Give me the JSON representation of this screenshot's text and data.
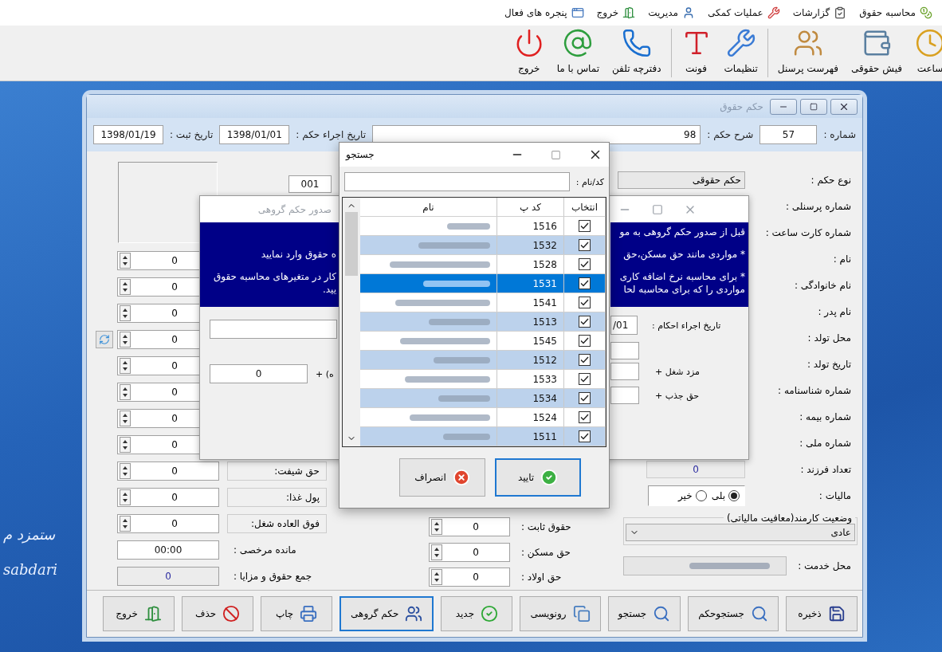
{
  "menu": [
    "محاسبه حقوق",
    "گزارشات",
    "عملیات کمکی",
    "مدیریت",
    "خروج",
    "پنجره های فعال"
  ],
  "toolbar": [
    [
      "ساعت",
      "فیش حقوقی",
      "فهرست پرسنل"
    ],
    [
      "تنظیمات",
      "فونت"
    ],
    [
      "دفترچه تلفن",
      "تماس با ما",
      "خروج"
    ]
  ],
  "desktop_text": [
    "ستمزد م",
    "sabdari"
  ],
  "main_window": {
    "title": "حکم حقوق",
    "header": [
      {
        "label": "شماره :",
        "value": "57"
      },
      {
        "label": "شرح حکم :",
        "value": "98"
      },
      {
        "label": "تاریخ اجراء حکم :",
        "value": "1398/01/01"
      },
      {
        "label": "تاریخ ثبت :",
        "value": "1398/01/19"
      }
    ],
    "code_field": "001",
    "left_rows": [
      {
        "kind": "spin",
        "value": "0"
      },
      {
        "kind": "spin",
        "value": "0"
      },
      {
        "kind": "spin",
        "value": "0"
      },
      {
        "kind": "spin",
        "value": "0",
        "refresh_button": true
      },
      {
        "kind": "spin",
        "value": "0"
      },
      {
        "kind": "spin",
        "value": "0"
      },
      {
        "kind": "spin",
        "value": "0"
      },
      {
        "kind": "spin",
        "value": "0"
      },
      {
        "kind": "spin",
        "value": "0",
        "label": "حق شیفت:"
      },
      {
        "kind": "spin",
        "value": "0",
        "label": "پول غذا:"
      },
      {
        "kind": "spin",
        "value": "0",
        "label": "فوق العاده شغل:"
      },
      {
        "kind": "time",
        "value": "00:00",
        "label": "مانده مرخصی :"
      },
      {
        "kind": "total",
        "value": "0",
        "label": "جمع حقوق و مزایا :"
      }
    ],
    "middle_rows": [
      {
        "label": "حقوق ثابت :",
        "value": "0"
      },
      {
        "label": "حق مسکن :",
        "value": "0"
      },
      {
        "label": "حق اولاد :",
        "value": "0"
      }
    ],
    "right_rows": [
      {
        "kind": "select",
        "label": "نوع حکم :",
        "value": "حکم حقوقی"
      },
      {
        "kind": "label",
        "label": "شماره پرسنلی :"
      },
      {
        "kind": "label",
        "label": "شماره کارت ساعت :"
      },
      {
        "kind": "label",
        "label": "نام :"
      },
      {
        "kind": "label",
        "label": "نام خانوادگی :"
      },
      {
        "kind": "label",
        "label": "نام پدر :"
      },
      {
        "kind": "label",
        "label": "محل تولد :"
      },
      {
        "kind": "label",
        "label": "تاریخ تولد :"
      },
      {
        "kind": "label",
        "label": "شماره شناسنامه :"
      },
      {
        "kind": "label",
        "label": "شماره بیمه :"
      },
      {
        "kind": "label",
        "label": "شماره ملی :"
      },
      {
        "kind": "readonly",
        "label": "تعداد فرزند :",
        "value": "0"
      },
      {
        "kind": "radio",
        "label": "مالیات :",
        "options": [
          {
            "label": "بلی",
            "selected": true
          },
          {
            "label": "خیر",
            "selected": false
          }
        ]
      }
    ],
    "status_group": {
      "title": "وضعیت کارمند(معافیت مالیاتی)",
      "value": "عادی"
    },
    "service_place": {
      "label": "محل خدمت :"
    },
    "buttons": [
      {
        "label": "ذخیره",
        "focused": false
      },
      {
        "label": "جستجوحکم",
        "focused": false
      },
      {
        "label": "جستجو",
        "focused": false
      },
      {
        "label": "رونویسی",
        "focused": false
      },
      {
        "label": "جدید",
        "focused": false
      },
      {
        "label": "حکم گروهی",
        "focused": true
      },
      {
        "label": "چاپ",
        "focused": false
      },
      {
        "label": "حذف",
        "focused": false
      },
      {
        "label": "خروج",
        "focused": false
      }
    ]
  },
  "group_dialog": {
    "title": "صدور حکم گروهی",
    "notice_lines": [
      {
        "kind": "start",
        "right": "قبل از صدور حکم گروهی به مو"
      },
      {
        "kind": "start",
        "right": "* مواردی مانند حق مسکن،حق",
        "left": "ه حقوق وارد نمایید"
      },
      {
        "kind": "start",
        "right": "* برای محاسبه نرخ اضافه کاری",
        "left": "کار در متغیرهای محاسبه حقوق"
      },
      {
        "kind": "continued",
        "right": "مواردی را که برای محاسبه لحا",
        "left": "یید."
      }
    ],
    "amount": {
      "value": "0",
      "label": "ه) +"
    },
    "date_label": "تاریخ اجراء احکام :",
    "date_value": "/01",
    "additions": [
      "مزد شغل +",
      "حق جذب +"
    ]
  },
  "search_dialog": {
    "title": "جستجو",
    "field_label": "کد/نام :",
    "columns": [
      "انتخاب",
      "کد پ",
      "نام"
    ],
    "rows": [
      {
        "code": "1516",
        "checked": true,
        "selected": false
      },
      {
        "code": "1532",
        "checked": true,
        "selected": false
      },
      {
        "code": "1528",
        "checked": true,
        "selected": false
      },
      {
        "code": "1531",
        "checked": true,
        "selected": true
      },
      {
        "code": "1541",
        "checked": true,
        "selected": false
      },
      {
        "code": "1513",
        "checked": true,
        "selected": false
      },
      {
        "code": "1545",
        "checked": true,
        "selected": false
      },
      {
        "code": "1512",
        "checked": true,
        "selected": false
      },
      {
        "code": "1533",
        "checked": true,
        "selected": false
      },
      {
        "code": "1534",
        "checked": true,
        "selected": false
      },
      {
        "code": "1524",
        "checked": true,
        "selected": false
      },
      {
        "code": "1511",
        "checked": true,
        "selected": false
      }
    ],
    "buttons": [
      {
        "label": "تایید",
        "focused": true
      },
      {
        "label": "انصراف",
        "focused": false
      }
    ]
  }
}
